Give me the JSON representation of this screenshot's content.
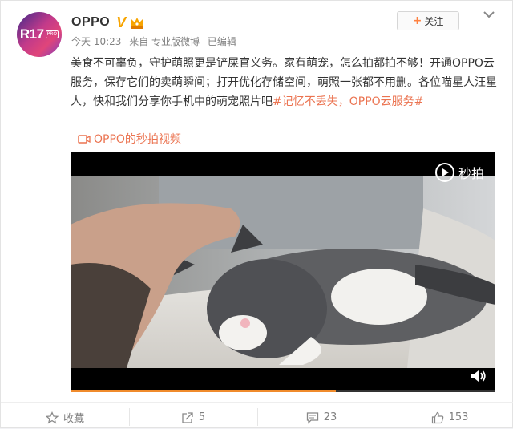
{
  "header": {
    "avatar_text": "R17",
    "avatar_badge": "PRO",
    "username": "OPPO",
    "verified_mark": "V",
    "follow_label": "关注",
    "follow_plus": "+"
  },
  "meta": {
    "time": "今天 10:23",
    "source": "来自 专业版微博",
    "edited": "已编辑"
  },
  "post": {
    "text": "美食不可辜负，守护萌照更是铲屎官义务。家有萌宠，怎么拍都拍不够！开通OPPO云服务，保存它们的卖萌瞬间；打开优化存储空间，萌照一张都不用删。各位喵星人汪星人，快和我们分享你手机中的萌宠照片吧",
    "topic": "#记忆不丢失，OPPO云服务#",
    "video_link": "OPPO的秒拍视频"
  },
  "player": {
    "logo_text": "秒拍",
    "progress": 0.625
  },
  "actions": {
    "favorite": "收藏",
    "repost": "5",
    "comment": "23",
    "like": "153"
  },
  "colors": {
    "accent": "#eb7350",
    "verified": "#f7a400",
    "progress": "#f08b2c"
  }
}
